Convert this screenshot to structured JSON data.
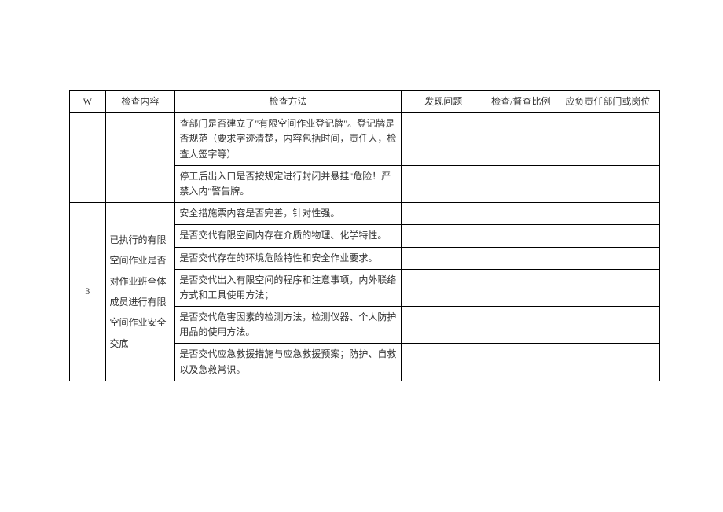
{
  "header": {
    "col_num": "W",
    "col_content": "检查内容",
    "col_method": "检查方法",
    "col_found": "发现问题",
    "col_ratio": "检查/督查比例",
    "col_dept": "应负责任部门或岗位"
  },
  "group1": {
    "num": "",
    "content": "",
    "methods": [
      "查部门是否建立了\"有限空间作业登记牌\"。登记牌是否规范（要求字迹清楚，内容包括时间，责任人，检查人签字等）",
      "停工后出入口是否按规定进行封闭并悬挂\"危险！严禁入内\"警告牌。"
    ]
  },
  "group2": {
    "num": "3",
    "content": "已执行的有限空间作业是否对作业班全体成员进行有限空间作业安全交底",
    "methods": [
      "安全措施票内容是否完善，针对性强。",
      "是否交代有限空间内存在介质的物理、化学特性。",
      "是否交代存在的环境危险特性和安全作业要求。",
      "是否交代出入有限空间的程序和注意事项，内外联络方式和工具使用方法；",
      "是否交代危害因素的检测方法，检测仪器、个人防护用品的使用方法。",
      "是否交代应急救援措施与应急救援预案；防护、自救以及急救常识。"
    ]
  }
}
